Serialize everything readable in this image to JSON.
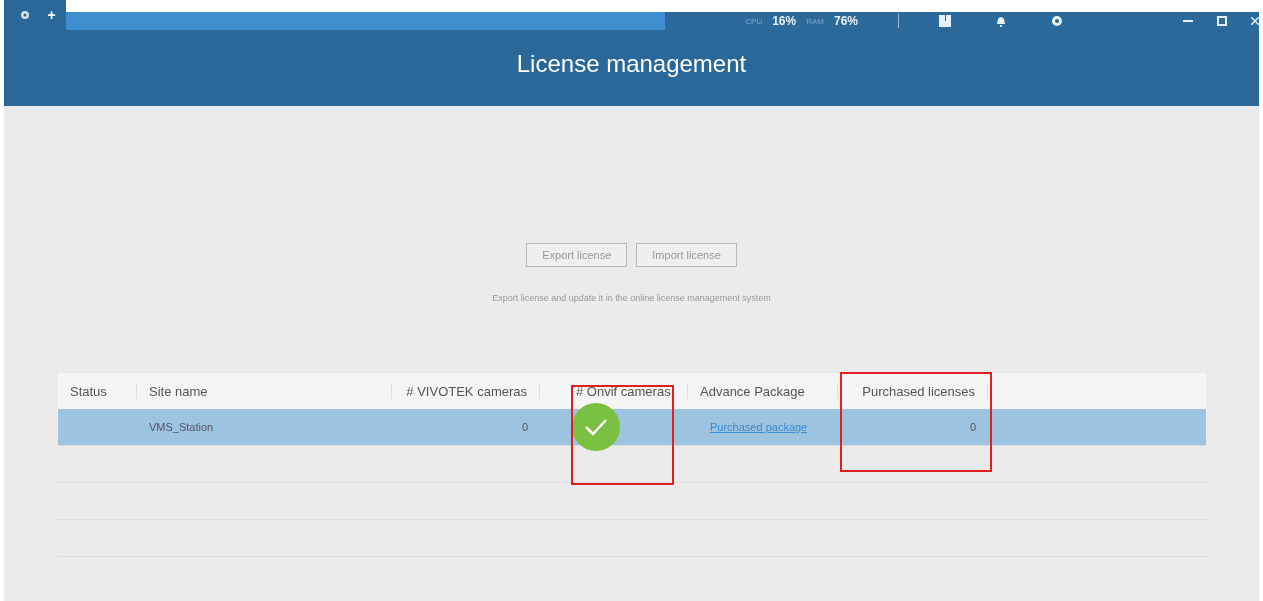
{
  "top_bar": {
    "add_label": "+",
    "cpu_label": "CPU",
    "cpu_value": "16%",
    "ram_label": "RAM",
    "ram_value": "76%"
  },
  "header": {
    "title": "License management"
  },
  "buttons": [
    "Export license",
    "Import license"
  ],
  "description": "Export license and update it in the online license management system",
  "table": {
    "columns": [
      "Status",
      "Site name",
      "# VIVOTEK cameras",
      "# Onvif cameras",
      "Advance Package",
      "Purchased licenses"
    ],
    "rows": [
      {
        "selected": true,
        "cells": [
          {
            "kind": "text",
            "text": ""
          },
          {
            "kind": "text",
            "text": "VMS_Station"
          },
          {
            "kind": "text",
            "text": "0"
          },
          {
            "kind": "check"
          },
          {
            "kind": "link",
            "text": "Purchased package"
          },
          {
            "kind": "text",
            "text": "0"
          }
        ]
      }
    ]
  }
}
